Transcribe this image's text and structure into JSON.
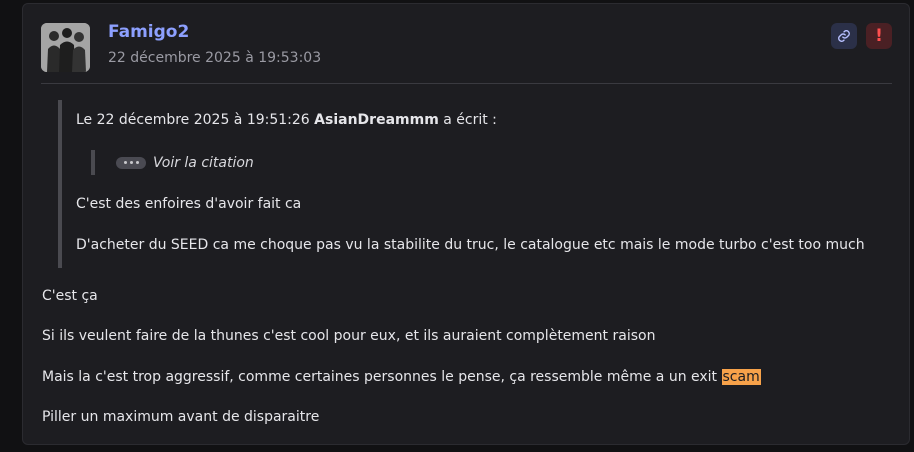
{
  "post": {
    "author": "Famigo2",
    "date": "22 décembre 2025 à 19:53:03",
    "avatar_icon": "avatar-group-silhouette",
    "actions": {
      "link_icon": "link-icon",
      "report_icon": "exclamation-icon",
      "report_glyph": "!"
    }
  },
  "quote": {
    "header_prefix": "Le 22 décembre 2025 à 19:51:26",
    "quoted_author": "AsianDreammm",
    "header_suffix": "a écrit :",
    "nested_label": "Voir la citation",
    "lines": [
      "C'est des enfoires d'avoir fait ca",
      "D'acheter du SEED ca me choque pas vu la stabilite du truc, le catalogue etc mais le mode turbo c'est too much"
    ]
  },
  "body": {
    "line1": "C'est ça",
    "line2": "Si ils veulent faire de la thunes c'est cool pour eux, et ils auraient complètement raison",
    "line3_text": "Mais la c'est trop aggressif, comme certaines personnes le pense, ça ressemble même a un exit ",
    "line3_highlight": "scam",
    "line4": "Piller un maximum avant de disparaitre"
  },
  "colors": {
    "background": "#1d1d21",
    "author": "#8da0ff",
    "highlight": "#f7a24a",
    "report": "#ff4f4f"
  }
}
